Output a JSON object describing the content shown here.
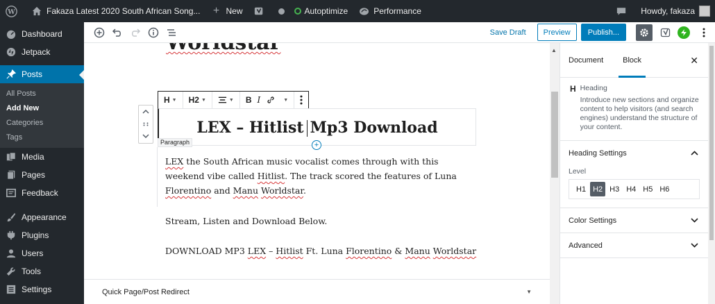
{
  "admin_bar": {
    "site_name": "Fakaza Latest 2020 South African Song...",
    "new_label": "New",
    "autoptimize_label": "Autoptimize",
    "performance_label": "Performance",
    "howdy_label": "Howdy, fakaza"
  },
  "sidebar": {
    "items": [
      {
        "label": "Dashboard",
        "icon": "dashboard-icon"
      },
      {
        "label": "Jetpack",
        "icon": "jetpack-icon"
      },
      {
        "label": "Posts",
        "icon": "pin-icon"
      },
      {
        "label": "Media",
        "icon": "media-icon"
      },
      {
        "label": "Pages",
        "icon": "pages-icon"
      },
      {
        "label": "Feedback",
        "icon": "feedback-icon"
      },
      {
        "label": "Appearance",
        "icon": "brush-icon"
      },
      {
        "label": "Plugins",
        "icon": "plugin-icon"
      },
      {
        "label": "Users",
        "icon": "users-icon"
      },
      {
        "label": "Tools",
        "icon": "wrench-icon"
      },
      {
        "label": "Settings",
        "icon": "settings-icon"
      }
    ],
    "posts_submenu": [
      "All Posts",
      "Add New",
      "Categories",
      "Tags"
    ]
  },
  "editor_header": {
    "save_draft": "Save Draft",
    "preview": "Preview",
    "publish": "Publish..."
  },
  "block_toolbar": {
    "heading_type": "H",
    "heading_level": "H2",
    "bold": "B",
    "italic": "I"
  },
  "content": {
    "previous_title_fragment": "Worldstar",
    "heading": {
      "before": "LEX – Hitlist",
      "after": "Mp3 Download"
    },
    "block_label": "Paragraph",
    "paragraph_1": {
      "p1": "LEX",
      "p2": " the South African music vocalist comes through with this weekend vibe called ",
      "p3": "Hitlist",
      "p4": ". The track scored the features of Luna ",
      "p5": "Florentino",
      "p6": " and ",
      "p7": "Manu",
      "p8": " ",
      "p9": "Worldstar",
      "p10": "."
    },
    "paragraph_2": "Stream, Listen and Download Below.",
    "paragraph_3": {
      "p1": "DOWNLOAD MP3 ",
      "p2": "LEX",
      "p3": " – ",
      "p4": "Hitlist",
      "p5": " Ft. Luna ",
      "p6": "Florentino",
      "p7": " & ",
      "p8": "Manu",
      "p9": " ",
      "p10": "Worldstar"
    }
  },
  "meta_box": {
    "title": "Quick Page/Post Redirect"
  },
  "settings_sidebar": {
    "tabs": [
      "Document",
      "Block"
    ],
    "active_tab": "Block",
    "block_card": {
      "icon_letter": "H",
      "title": "Heading",
      "description": "Introduce new sections and organize content to help visitors (and search engines) understand the structure of your content."
    },
    "heading_settings": {
      "title": "Heading Settings",
      "level_label": "Level",
      "levels": [
        "H1",
        "H2",
        "H3",
        "H4",
        "H5",
        "H6"
      ],
      "selected_level": "H2"
    },
    "color_settings": "Color Settings",
    "advanced": "Advanced"
  }
}
